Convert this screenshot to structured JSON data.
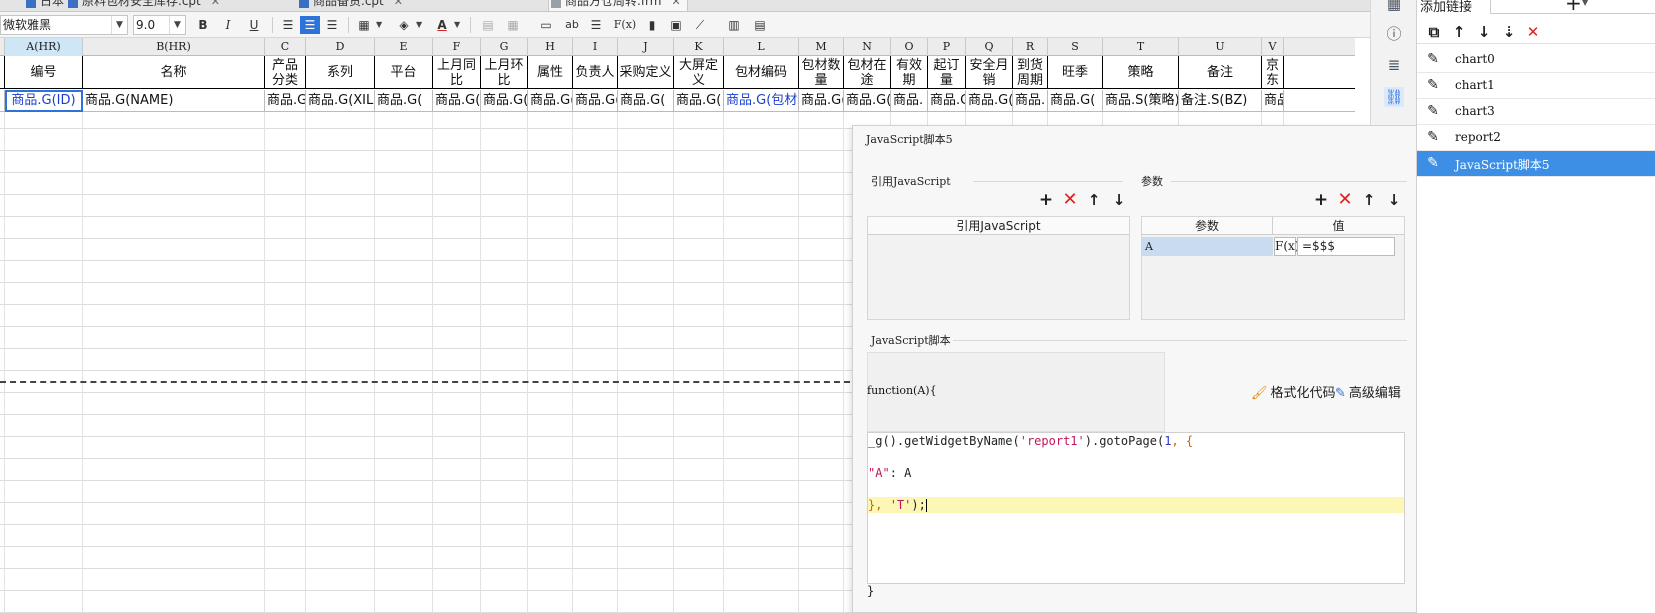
{
  "tabs": [
    {
      "label": "日本",
      "active": false
    },
    {
      "label": "原料包材安全库存.cpt",
      "active": false
    },
    {
      "label": "商品备货.cpt",
      "active": false
    },
    {
      "label": "商品方仓周转.frm",
      "active": true
    }
  ],
  "toolbar": {
    "font_name": "微软雅黑",
    "font_size": "9.0",
    "bold": "B",
    "italic": "I",
    "underline": "U",
    "text_color_glyph": "A",
    "formula_glyph": "F(x)",
    "ab_glyph": "ab"
  },
  "grid": {
    "columns": [
      {
        "id": "",
        "w": 5
      },
      {
        "id": "A(HR)",
        "w": 78,
        "selected": true
      },
      {
        "id": "B(HR)",
        "w": 182
      },
      {
        "id": "C",
        "w": 41
      },
      {
        "id": "D",
        "w": 69
      },
      {
        "id": "E",
        "w": 58
      },
      {
        "id": "F",
        "w": 48
      },
      {
        "id": "G",
        "w": 47
      },
      {
        "id": "H",
        "w": 45
      },
      {
        "id": "I",
        "w": 45
      },
      {
        "id": "J",
        "w": 56
      },
      {
        "id": "K",
        "w": 50
      },
      {
        "id": "L",
        "w": 75
      },
      {
        "id": "M",
        "w": 45
      },
      {
        "id": "N",
        "w": 47
      },
      {
        "id": "O",
        "w": 37
      },
      {
        "id": "P",
        "w": 38
      },
      {
        "id": "Q",
        "w": 47
      },
      {
        "id": "R",
        "w": 35
      },
      {
        "id": "S",
        "w": 55
      },
      {
        "id": "T",
        "w": 76
      },
      {
        "id": "U",
        "w": 83
      },
      {
        "id": "V",
        "w": 22
      }
    ],
    "headers": [
      "",
      "编号",
      "名称",
      "产品分类",
      "系列",
      "平台",
      "上月同比",
      "上月环比",
      "属性",
      "负责人",
      "采购定义",
      "大屏定义",
      "包材编码",
      "包材数量",
      "包材在途",
      "有效期",
      "起订量",
      "安全月销",
      "到货周期",
      "旺季",
      "策略",
      "备注",
      "京东"
    ],
    "row1": [
      "",
      "商品.G(ID)",
      "商品.G(NAME)",
      "商品.G(",
      "商品.G(XILIE",
      "商品.G(",
      "商品.G(",
      "商品.G(",
      "商品.G(",
      "商品.G(",
      "商品.G(",
      "商品.G(",
      "商品.G(包材编",
      "商品.G(",
      "商品.G(",
      "商品.",
      "商品.G(",
      "商品.G(",
      "商品.",
      "商品.G(",
      "商品.S(策略)",
      "备注.S(BZ)",
      "商品"
    ]
  },
  "js_dialog": {
    "title": "JavaScript脚本5",
    "ref_section": "引用JavaScript",
    "ref_header": "引用JavaScript",
    "param_section": "参数",
    "param_header": "参数",
    "value_header": "值",
    "param_name": "A",
    "param_fx": "F(x)",
    "param_value": "=$$$",
    "script_section": "JavaScript脚本",
    "function_sig": "function(A){",
    "format_label": "格式化代码",
    "advanced_label": "高级编辑",
    "code_line1_a": "_g().getWidgetByName(",
    "code_line1_b": "'report1'",
    "code_line1_c": ").gotoPage(",
    "code_line1_d": "1",
    "code_line1_e": ", {",
    "code_line2_key": "\"A\"",
    "code_line2_rest": ": A",
    "code_line3_a": "}, ",
    "code_line3_b": "'T'",
    "code_line3_c": ");",
    "closing": "}"
  },
  "right_panel": {
    "title": "添加链接",
    "items": [
      {
        "label": "chart0",
        "selected": false
      },
      {
        "label": "chart1",
        "selected": false
      },
      {
        "label": "chart3",
        "selected": false
      },
      {
        "label": "report2",
        "selected": false
      },
      {
        "label": "JavaScript脚本5",
        "selected": true
      }
    ]
  },
  "icons": {
    "strip": [
      "table-icon",
      "info-sheet-icon",
      "layers-icon",
      "link-icon"
    ],
    "colors": {
      "accent": "#2d73d9",
      "selection": "#3d8fe6",
      "delete": "#e02020"
    }
  }
}
